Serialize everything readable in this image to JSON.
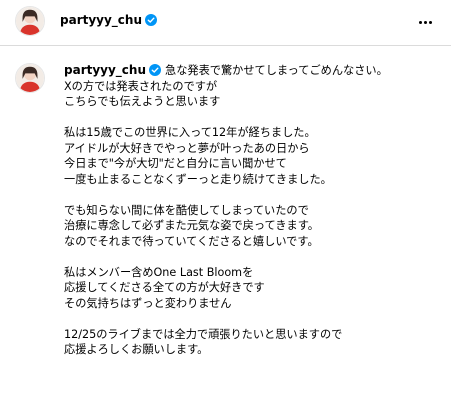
{
  "header": {
    "username": "partyyy_chu"
  },
  "post": {
    "username": "partyyy_chu",
    "caption_lines": [
      "急な発表で驚かせてしまってごめんなさい。",
      "Xの方では発表されたのですが",
      "こちらでも伝えようと思います",
      "",
      "私は15歳でこの世界に入って12年が経ちました。",
      "アイドルが大好きでやっと夢が叶ったあの日から",
      "今日まで\"今が大切\"だと自分に言い聞かせて",
      "一度も止まることなくずーっと走り続けてきました。",
      "",
      "でも知らない間に体を酷使してしまっていたので",
      "治療に専念して必ずまた元気な姿で戻ってきます。",
      "なのでそれまで待っていてくださると嬉しいです。",
      "",
      "私はメンバー含めOne Last Bloomを",
      "応援してくださる全ての方が大好きです",
      "その気持ちはずっと変わりません",
      "",
      "12/25のライブまでは全力で頑張りたいと思いますので",
      "応援よろしくお願いします。"
    ]
  },
  "colors": {
    "verified": "#0095f6",
    "divider": "#dbdbdb",
    "avatar_outfit": "#d9342b"
  },
  "icons": [
    "verified-badge-icon",
    "more-options-icon"
  ]
}
